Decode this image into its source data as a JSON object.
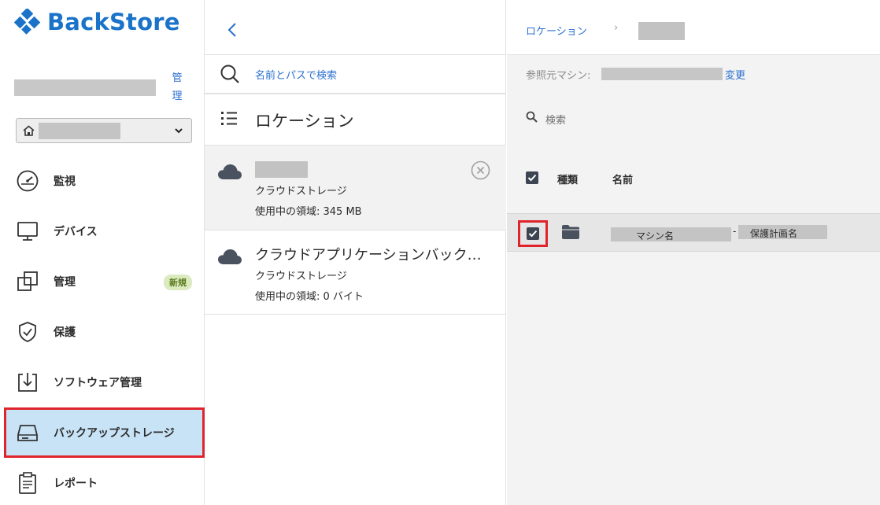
{
  "brand": {
    "name": "BackStore",
    "accent_color": "#1a73c8"
  },
  "account": {
    "manage_label": "管理"
  },
  "nav": {
    "items": [
      {
        "label": "監視",
        "icon": "gauge-icon"
      },
      {
        "label": "デバイス",
        "icon": "monitor-icon"
      },
      {
        "label": "管理",
        "icon": "management-icon",
        "badge": "新規"
      },
      {
        "label": "保護",
        "icon": "shield-icon"
      },
      {
        "label": "ソフトウェア管理",
        "icon": "software-install-icon"
      },
      {
        "label": "バックアップストレージ",
        "icon": "storage-drive-icon",
        "active": true
      },
      {
        "label": "レポート",
        "icon": "report-icon"
      }
    ]
  },
  "middle": {
    "search_label": "名前とパスで検索",
    "section_title": "ロケーション",
    "locations": [
      {
        "name": "",
        "type": "クラウドストレージ",
        "usage": "使用中の領域: 345 MB",
        "selected": true
      },
      {
        "name": "クラウドアプリケーションバックアップ",
        "type": "クラウドストレージ",
        "usage": "使用中の領域: 0 バイト",
        "selected": false
      }
    ]
  },
  "right": {
    "breadcrumb_root": "ロケーション",
    "breadcrumb_sep": "›",
    "ref_label": "参照元マシン:",
    "ref_change": "変更",
    "search_placeholder": "検索",
    "columns": {
      "type": "種類",
      "name": "名前"
    },
    "rows": [
      {
        "machine_label": "マシン名",
        "separator": "-",
        "plan_label": "保護計画名",
        "checked": true
      }
    ]
  },
  "colors": {
    "highlight_red": "#e0242c",
    "active_bg": "#c9e3f6",
    "link_blue": "#2a6fd1"
  }
}
